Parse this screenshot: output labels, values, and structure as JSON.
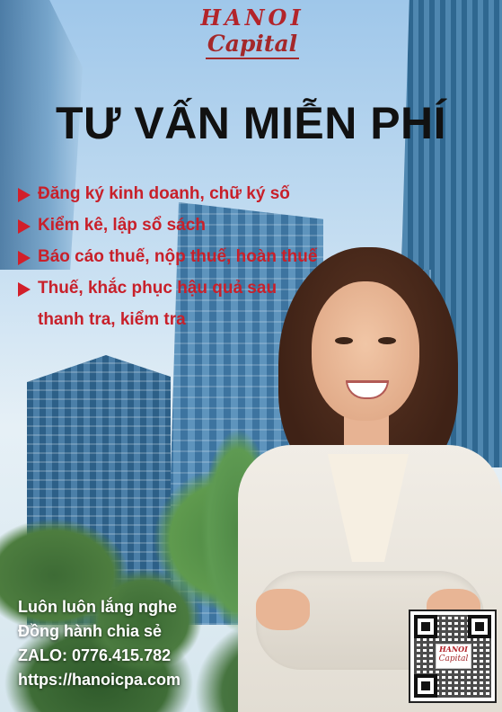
{
  "logo": {
    "top": "HANOI",
    "bottom": "Capital"
  },
  "title": "TƯ VẤN MIỄN PHÍ",
  "services": [
    "Đăng ký kinh doanh, chữ ký số",
    "Kiểm kê, lập sổ sách",
    "Báo cáo thuế, nộp thuế, hoàn thuế",
    "Thuế, khắc phục hậu quả sau"
  ],
  "services_continuation": "thanh tra, kiểm tra",
  "footer": {
    "line1": "Luôn luôn lắng nghe",
    "line2": "Đồng hành chia sẻ",
    "zalo": "ZALO: 0776.415.782",
    "website": "https://hanoicpa.com"
  },
  "qr_logo": {
    "top": "HANOI",
    "bottom": "Capital"
  },
  "colors": {
    "accent_red": "#c8202a",
    "logo_red": "#b3242a",
    "title": "#111111",
    "footer_text": "#ffffff"
  },
  "icons": {
    "bullet": "triangle-right-icon",
    "qr": "qr-code-icon"
  }
}
